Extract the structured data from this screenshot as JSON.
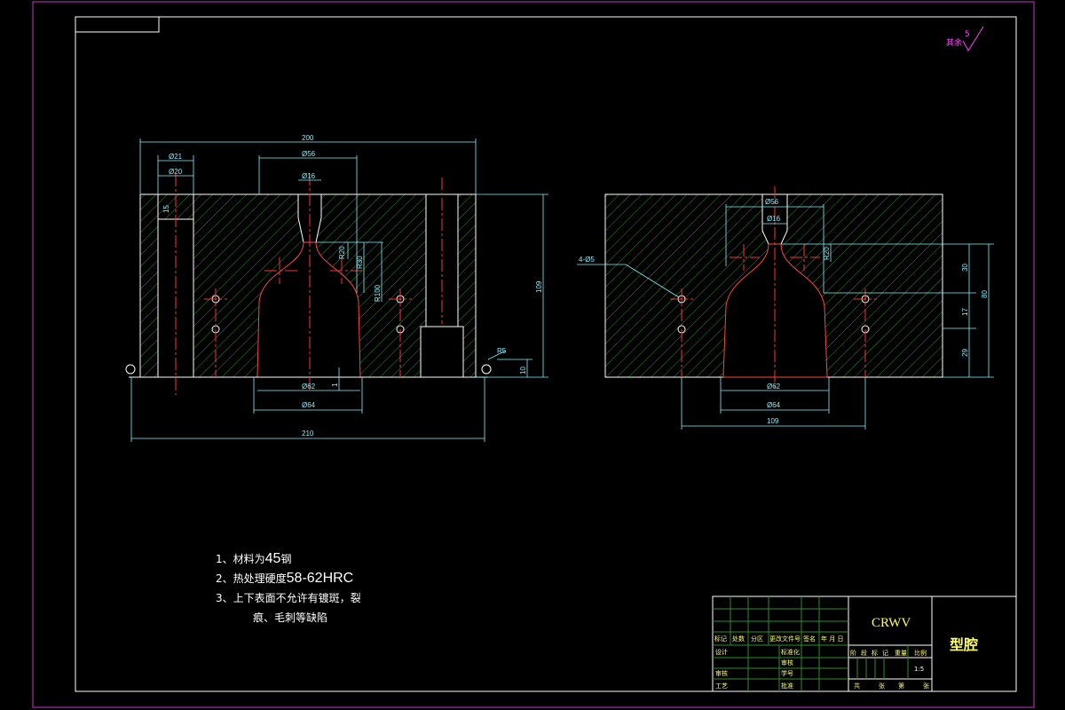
{
  "roughness": {
    "value": "5",
    "label": "其余"
  },
  "front_view": {
    "dims": {
      "overall_width": "200",
      "d21": "Ø21",
      "d20": "Ø20",
      "depth15": "15",
      "d56": "Ø56",
      "d16": "Ø16",
      "r20": "R20",
      "r30": "R30",
      "r100": "R100",
      "height109": "109",
      "r5": "R5",
      "h10": "10",
      "h1": "1",
      "d62": "Ø62",
      "d64": "Ø64",
      "base210": "210"
    }
  },
  "side_view": {
    "dims": {
      "d56": "Ø56",
      "d16": "Ø16",
      "r20": "R20",
      "holes": "4-Ø5",
      "h30": "30",
      "h80": "80",
      "h17": "17",
      "h29": "29",
      "d62": "Ø62",
      "d64": "Ø64",
      "w109": "109"
    }
  },
  "notes": {
    "line1_prefix": "1、材料为",
    "line1_big": "45",
    "line1_suffix": "钢",
    "line2_prefix": "2、热处理硬度",
    "line2_big": "58-62HRC",
    "line3": "3、上下表面不允许有镀斑，裂",
    "line4": "痕、毛刺等缺陷"
  },
  "title_block": {
    "code": "CRWV",
    "part_name": "型腔",
    "scale": "1:5",
    "rev_headers": [
      "标记",
      "处数",
      "分区",
      "更改文件号",
      "签名",
      "年 月 日"
    ],
    "design": "设计",
    "standardization": "标准化",
    "review": "审核",
    "process": "工艺",
    "audit": "审核",
    "approve": "批准",
    "student_no": "学号",
    "stage_headers": [
      "阶",
      "段",
      "标",
      "记",
      "重量",
      "比例"
    ],
    "sheet": [
      "共",
      "张",
      "第",
      "张"
    ]
  }
}
